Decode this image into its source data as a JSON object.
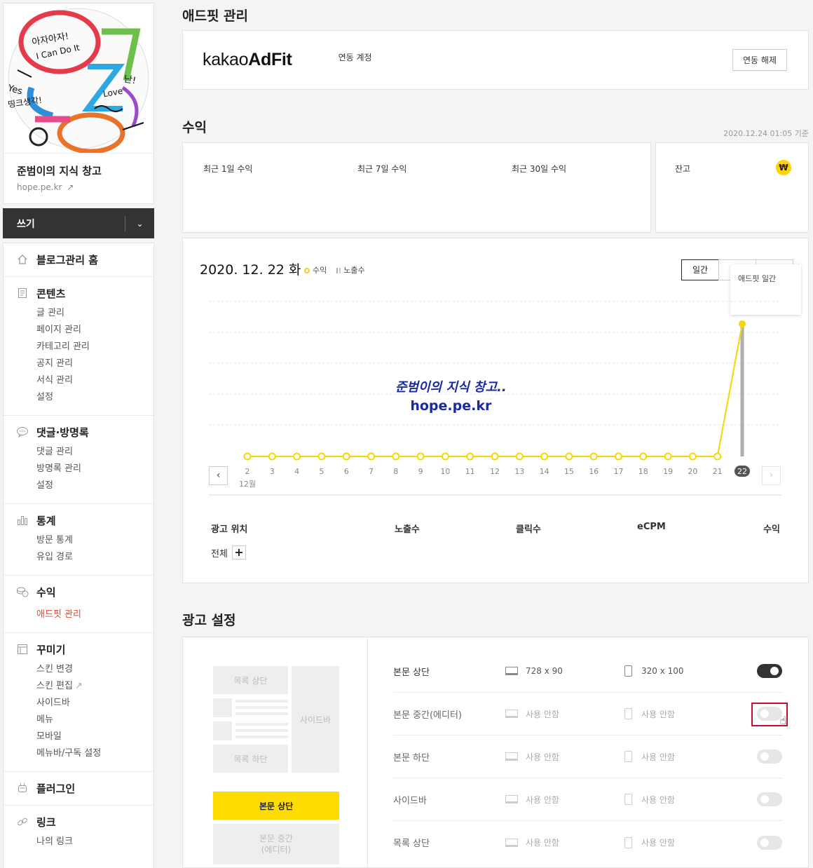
{
  "sidebar": {
    "blog_name": "준범이의 지식 창고",
    "blog_url": "hope.pe.kr",
    "profile_image_text": [
      "아자아자!",
      "I Can Do It",
      "Yes",
      "띵크생각!",
      "Love",
      "난!"
    ],
    "write_label": "쓰기",
    "groups": [
      {
        "icon": "home-icon",
        "label": "블로그관리 홈",
        "items": []
      },
      {
        "icon": "document-icon",
        "label": "콘텐츠",
        "items": [
          "글 관리",
          "페이지 관리",
          "카테고리 관리",
          "공지 관리",
          "서식 관리",
          "설정"
        ]
      },
      {
        "icon": "comment-icon",
        "label": "댓글·방명록",
        "items": [
          "댓글 관리",
          "방명록 관리",
          "설정"
        ]
      },
      {
        "icon": "stats-icon",
        "label": "통계",
        "items": [
          "방문 통계",
          "유입 경로"
        ]
      },
      {
        "icon": "coins-icon",
        "label": "수익",
        "items": [
          "애드핏 관리"
        ]
      },
      {
        "icon": "layout-icon",
        "label": "꾸미기",
        "items": [
          "스킨 변경",
          "스킨 편집",
          "사이드바",
          "메뉴",
          "모바일",
          "메뉴바/구독 설정"
        ]
      },
      {
        "icon": "plugin-icon",
        "label": "플러그인",
        "items": []
      },
      {
        "icon": "link-icon",
        "label": "링크",
        "items": [
          "나의 링크"
        ]
      }
    ]
  },
  "adfit": {
    "title": "애드핏 관리",
    "logo_light": "kakao",
    "logo_bold": "AdFit",
    "linked_label": "연동 계정",
    "unlink_button": "연동 해제"
  },
  "revenue": {
    "title": "수익",
    "timestamp": "2020.12.24 01:05 기준",
    "col_1day": "최근 1일 수익",
    "col_7day": "최근 7일 수익",
    "col_30day": "최근 30일 수익",
    "balance_label": "잔고",
    "currency_icon": "₩"
  },
  "chart": {
    "date": "2020. 12. 22",
    "weekday": "화",
    "legend_revenue": "수익",
    "legend_impressions": "노출수",
    "tab_daily": "일간",
    "tooltip_title": "애드핏 일간",
    "watermark_line1": "준범이의 지식 창고..",
    "watermark_line2": "hope.pe.kr",
    "month_label": "12월",
    "selected_day": "22",
    "prev_arrow": "‹",
    "next_arrow": "›",
    "colors": {
      "revenue_line": "#f5d800",
      "impression_bar": "#aab0b4",
      "selected_badge": "#555555"
    }
  },
  "chart_data": {
    "type": "line",
    "x": [
      "2",
      "3",
      "4",
      "5",
      "6",
      "7",
      "8",
      "9",
      "10",
      "11",
      "12",
      "13",
      "14",
      "15",
      "16",
      "17",
      "18",
      "19",
      "20",
      "21",
      "22"
    ],
    "series": [
      {
        "name": "수익",
        "values": [
          0,
          0,
          0,
          0,
          0,
          0,
          0,
          0,
          0,
          0,
          0,
          0,
          0,
          0,
          0,
          0,
          0,
          0,
          0,
          0,
          1
        ]
      },
      {
        "name": "노출수",
        "values": [
          0,
          0,
          0,
          0,
          0,
          0,
          0,
          0,
          0,
          0,
          0,
          0,
          0,
          0,
          0,
          0,
          0,
          0,
          0,
          0,
          1
        ]
      }
    ],
    "grid": true,
    "legend": "top-left"
  },
  "table": {
    "col_position": "광고 위치",
    "col_impressions": "노출수",
    "col_clicks": "클릭수",
    "col_ecpm": "eCPM",
    "col_revenue": "수익",
    "row_total": "전체",
    "expand_button": "+"
  },
  "ad_settings": {
    "title": "광고 설정",
    "preview": {
      "list_top": "목록 상단",
      "sidebar": "사이드바",
      "list_bottom": "목록 하단",
      "body_top": "본문 상단",
      "body_middle_1": "본문 중간",
      "body_middle_2": "(에디터)"
    },
    "rows": [
      {
        "name": "본문 상단",
        "desktop": "728 x 90",
        "mobile": "320 x 100",
        "enabled": true
      },
      {
        "name": "본문 중간(에디터)",
        "desktop": "사용 안함",
        "mobile": "사용 안함",
        "enabled": false
      },
      {
        "name": "본문 하단",
        "desktop": "사용 안함",
        "mobile": "사용 안함",
        "enabled": false
      },
      {
        "name": "사이드바",
        "desktop": "사용 안함",
        "mobile": "사용 안함",
        "enabled": false
      },
      {
        "name": "목록 상단",
        "desktop": "사용 안함",
        "mobile": "사용 안함",
        "enabled": false
      }
    ]
  }
}
